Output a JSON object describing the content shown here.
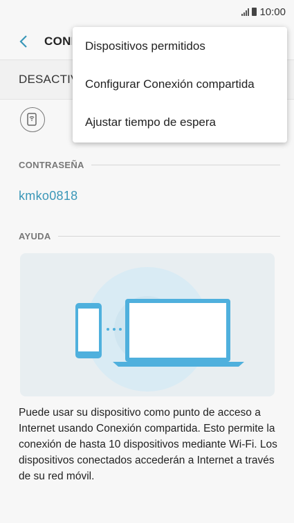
{
  "status_bar": {
    "time": "10:00",
    "icons": [
      "signal-icon",
      "battery-icon"
    ]
  },
  "app_bar": {
    "title": "CONEXIÓN COMPARTIDA Y ZONA WI-FI MÓVIL",
    "back_icon": "chevron-left-icon"
  },
  "switch_row": {
    "label": "DESACTIVADO"
  },
  "qr_button": {
    "icon": "qr-code-icon"
  },
  "password_section": {
    "header": "CONTRASEÑA",
    "value": "kmko0818"
  },
  "help_section": {
    "header": "AYUDA",
    "illustration": "phone-laptop-connection-illustration",
    "text": "Puede usar su dispositivo como punto de acceso a Internet usando Conexión compartida. Esto permite la conexión de hasta 10 dispositivos mediante Wi-Fi. Los dispositivos conectados accederán a Internet a través de su red móvil."
  },
  "menu": {
    "items": [
      {
        "label": "Dispositivos permitidos"
      },
      {
        "label": "Configurar Conexión compartida"
      },
      {
        "label": "Ajustar tiempo de espera"
      }
    ]
  },
  "colors": {
    "accent": "#3a97b8",
    "illustration_blue": "#4fb0dd",
    "background": "#f7f7f7"
  }
}
